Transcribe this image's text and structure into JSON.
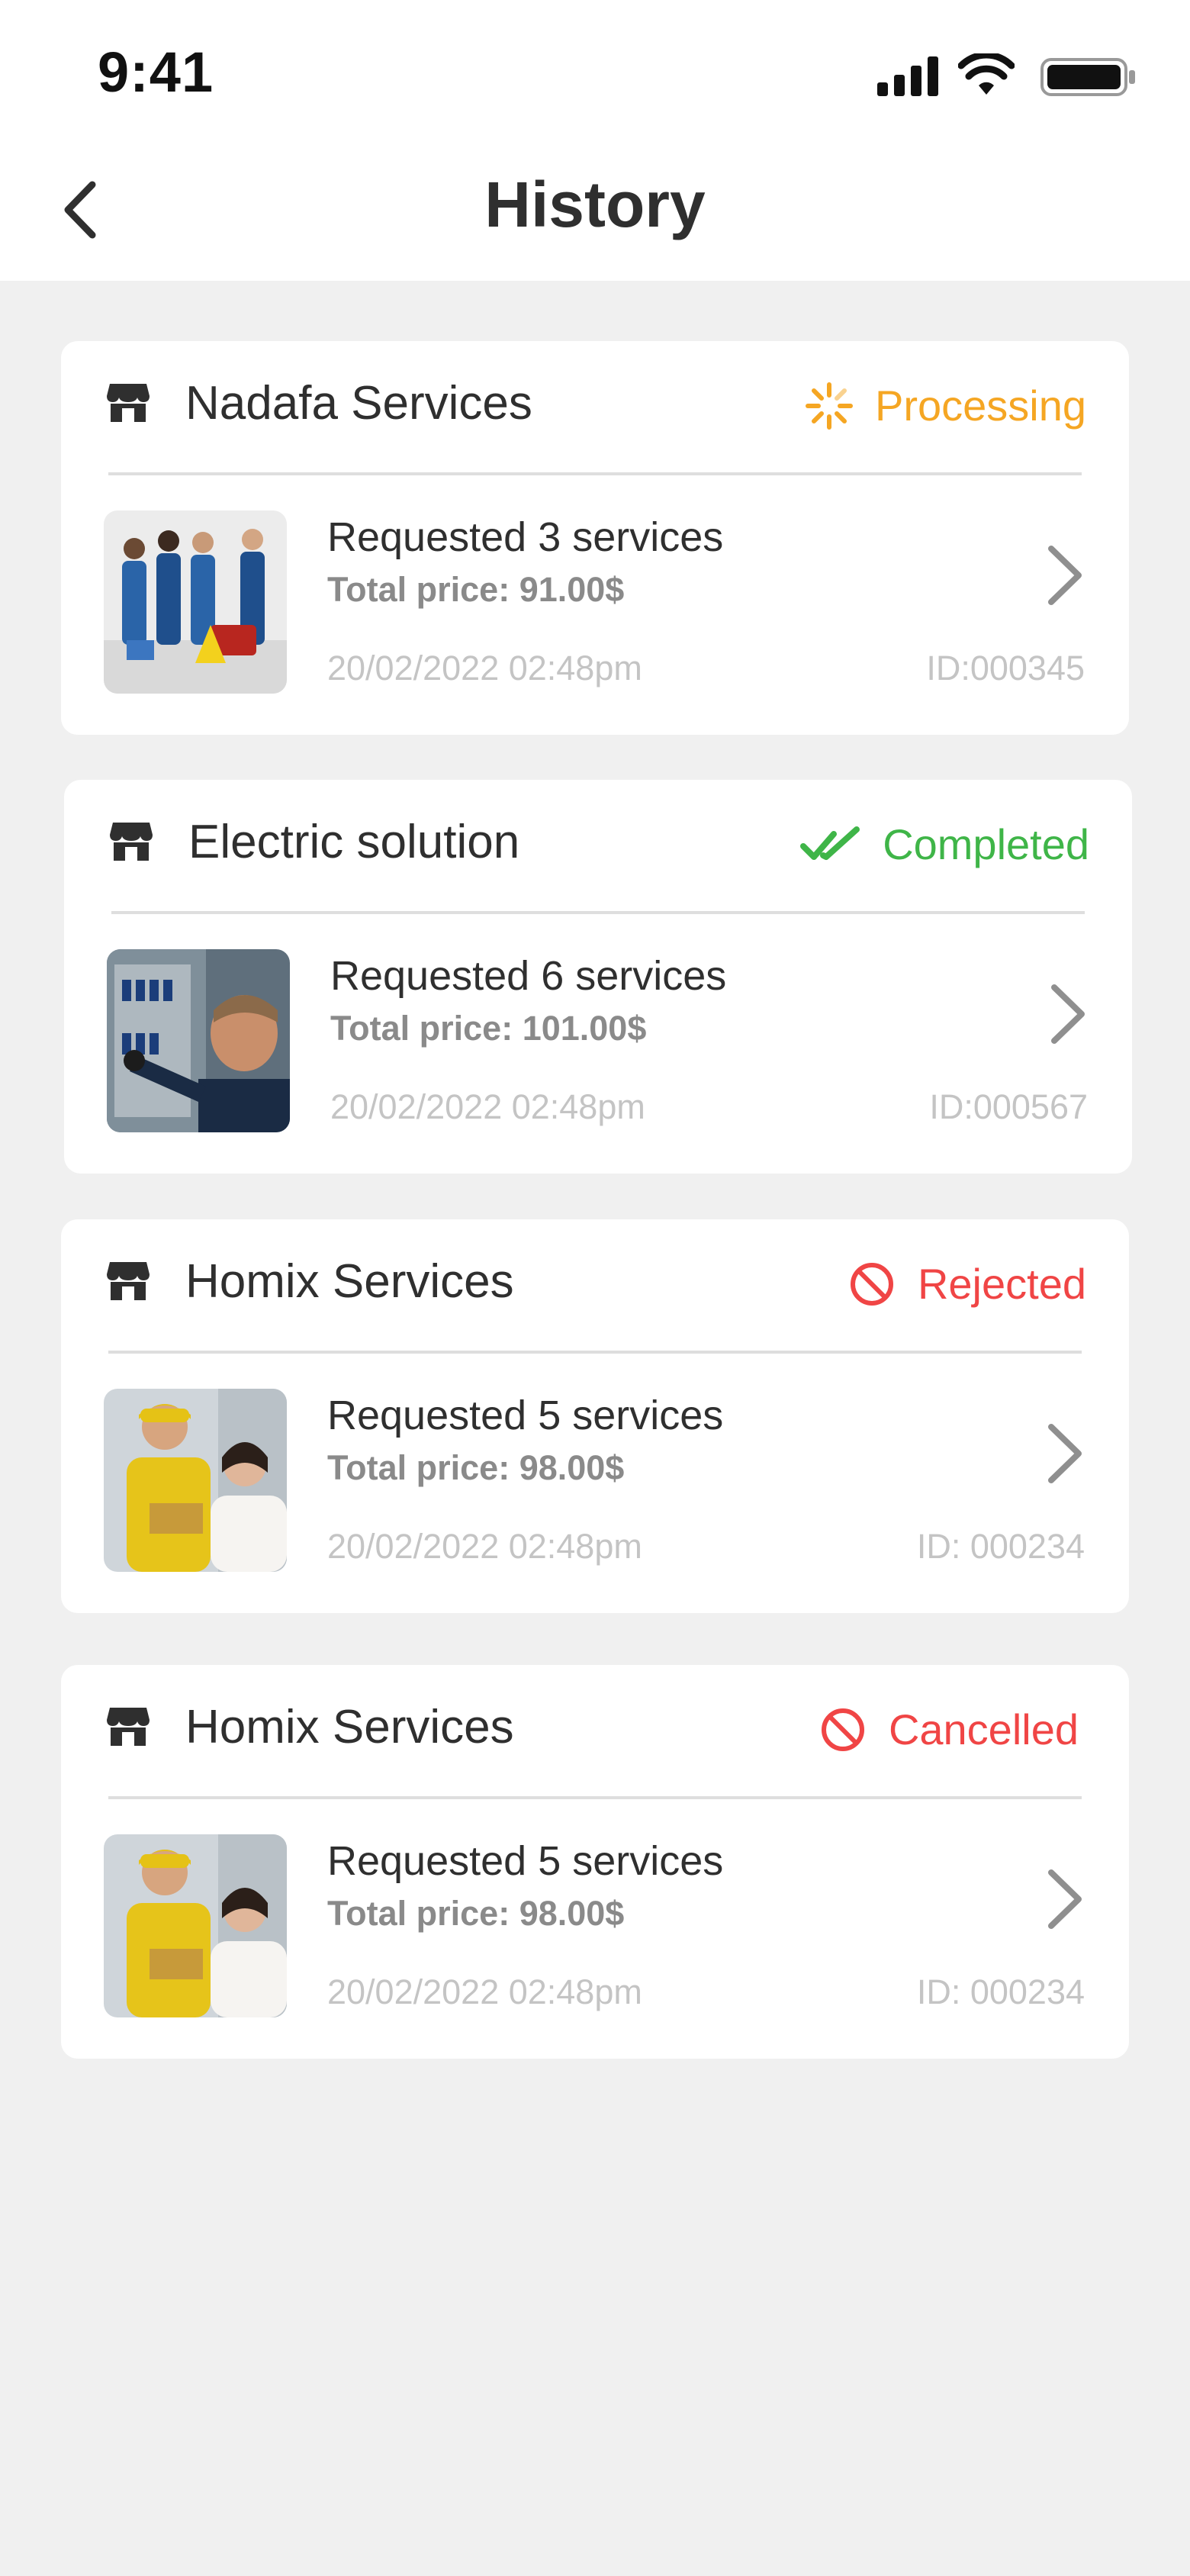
{
  "status_bar": {
    "time": "9:41"
  },
  "header": {
    "title": "History"
  },
  "colors": {
    "processing": "#f5a623",
    "completed": "#3fb548",
    "rejected": "#f04545",
    "cancelled": "#f04545"
  },
  "orders": [
    {
      "store": "Nadafa Services",
      "status": "Processing",
      "request": "Requested 3 services",
      "price": "Total price: 91.00$",
      "date": "20/02/2022  02:48pm",
      "id": "ID:000345",
      "status_icon": "loading-spinner-icon",
      "image": "cleaning-team-photo"
    },
    {
      "store": "Electric solution",
      "status": "Completed",
      "request": "Requested 6 services",
      "price": "Total price: 101.00$",
      "date": "20/02/2022  02:48pm",
      "id": "ID:000567",
      "status_icon": "double-check-icon",
      "image": "electrician-photo"
    },
    {
      "store": "Homix Services",
      "status": "Rejected",
      "request": "Requested 5 services",
      "price": "Total price: 98.00$",
      "date": "20/02/2022  02:48pm",
      "id": "ID: 000234",
      "status_icon": "prohibited-icon",
      "image": "technician-customer-photo"
    },
    {
      "store": "Homix Services",
      "status": "Cancelled",
      "request": "Requested 5 services",
      "price": "Total price: 98.00$",
      "date": "20/02/2022  02:48pm",
      "id": "ID: 000234",
      "status_icon": "prohibited-icon",
      "image": "technician-customer-photo"
    }
  ]
}
